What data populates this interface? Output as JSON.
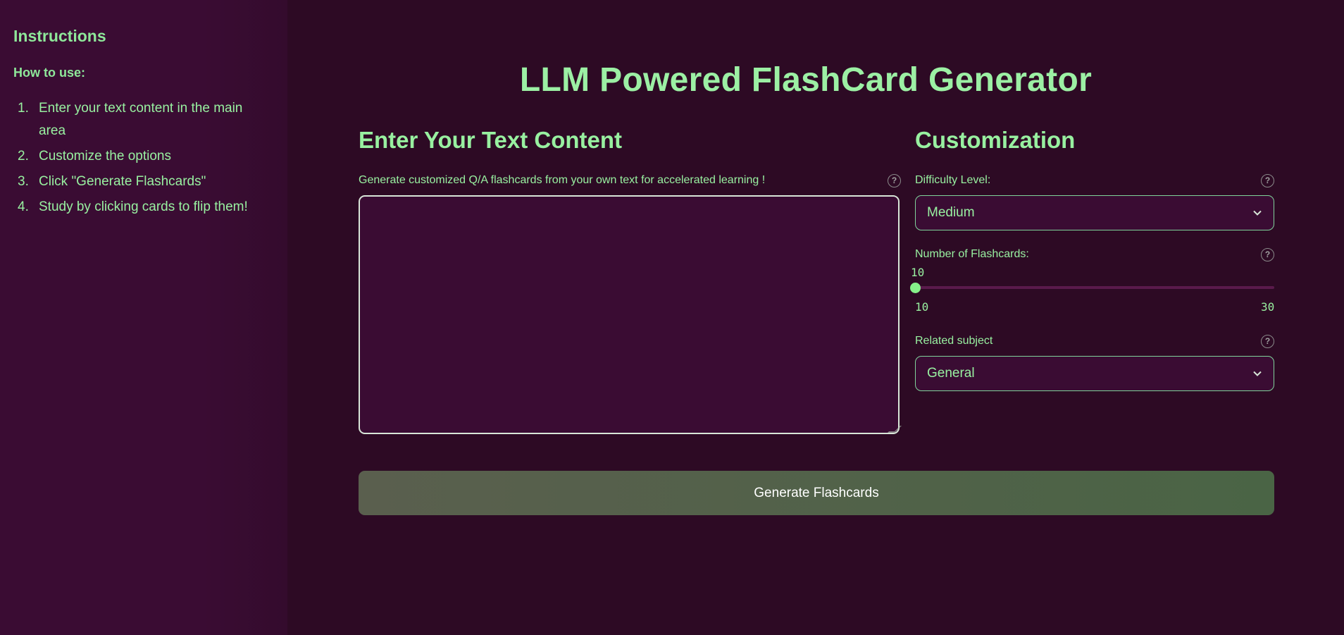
{
  "sidebar": {
    "title": "Instructions",
    "subtitle": "How to use:",
    "steps": [
      {
        "num": "1.",
        "text": "Enter your text content in the main area"
      },
      {
        "num": "2.",
        "text": "Customize the options"
      },
      {
        "num": "3.",
        "text": "Click \"Generate Flashcards\""
      },
      {
        "num": "4.",
        "text": "Study by clicking cards to flip them!"
      }
    ]
  },
  "main": {
    "title": "LLM Powered FlashCard Generator",
    "text_section": {
      "title": "Enter Your Text Content",
      "label": "Generate customized Q/A flashcards from your own text for accelerated learning !",
      "value": "",
      "help_icon": "question-circle-icon"
    },
    "customization": {
      "title": "Customization",
      "difficulty": {
        "label": "Difficulty Level:",
        "selected": "Medium"
      },
      "flashcards": {
        "label": "Number of Flashcards:",
        "value": "10",
        "min": "10",
        "max": "30"
      },
      "subject": {
        "label": "Related subject",
        "selected": "General"
      }
    },
    "generate_label": "Generate Flashcards"
  },
  "colors": {
    "background": "#2d0a24",
    "sidebar": "#3a0c33",
    "accent_text": "#98f0a0",
    "slider_thumb": "#86f08a",
    "button": "#4f6249"
  }
}
